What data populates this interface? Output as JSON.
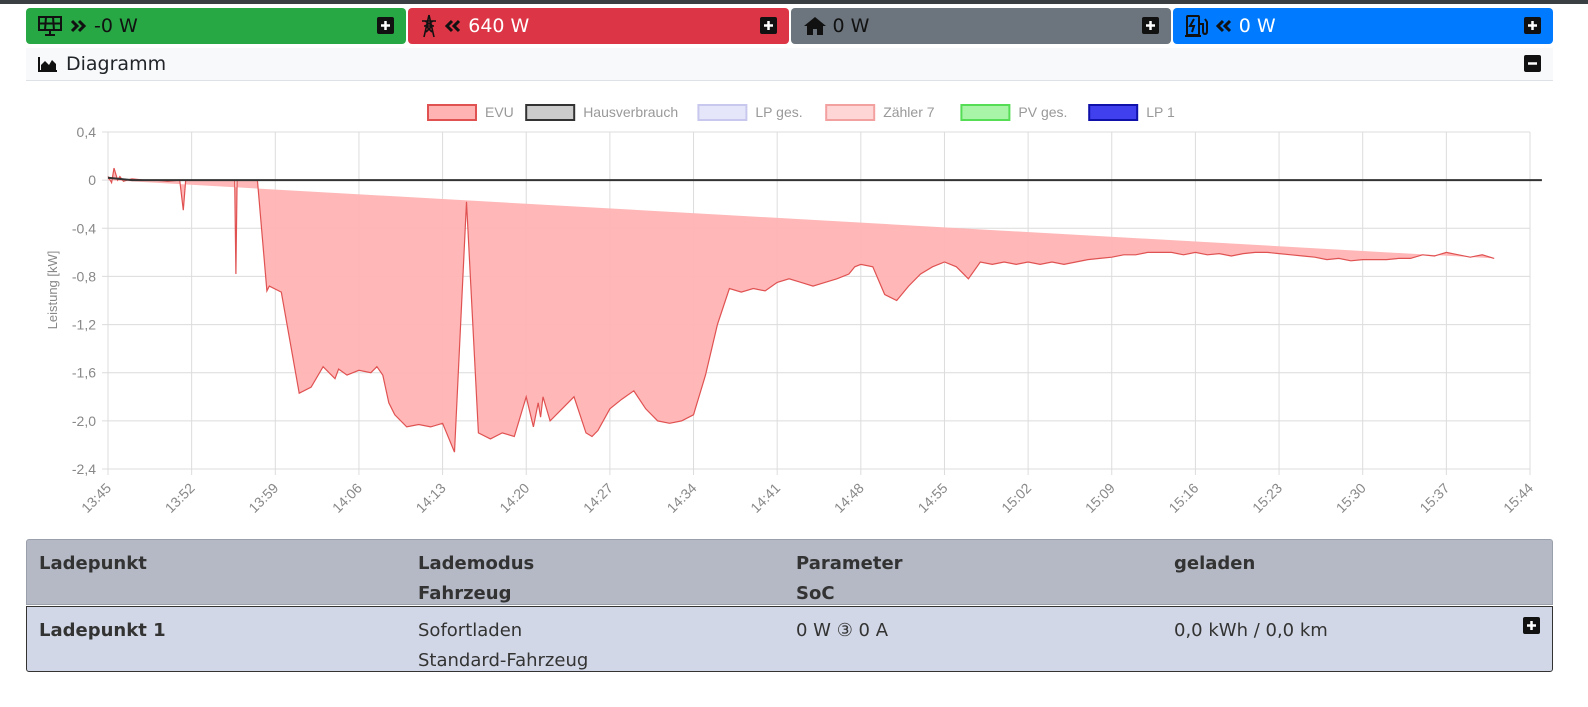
{
  "tiles": [
    {
      "label": "-0 W",
      "color": "#28a745",
      "icon": "solar-panel-icon"
    },
    {
      "label": "640 W",
      "color": "#dc3545",
      "icon": "power-tower-icon"
    },
    {
      "label": "0 W",
      "color": "#6c757d",
      "icon": "home-icon"
    },
    {
      "label": "0 W",
      "color": "#007bff",
      "icon": "charging-station-icon"
    }
  ],
  "diagram": {
    "title": "Diagramm"
  },
  "chart_data": {
    "type": "area",
    "ylabel": "Leistung [kW]",
    "ylim": [
      -2.4,
      0.4
    ],
    "yticks": [
      "0,4",
      "0",
      "-0,4",
      "-0,8",
      "-1,2",
      "-1,6",
      "-2,0",
      "-2,4"
    ],
    "xticks": [
      "13:45",
      "13:52",
      "13:59",
      "14:06",
      "14:13",
      "14:20",
      "14:27",
      "14:34",
      "14:41",
      "14:48",
      "14:55",
      "15:02",
      "15:09",
      "15:16",
      "15:23",
      "15:30",
      "15:37",
      "15:44"
    ],
    "legend": [
      {
        "name": "EVU",
        "fill": "#ffb3b3",
        "stroke": "#e05252"
      },
      {
        "name": "Hausverbrauch",
        "fill": "#cccccc",
        "stroke": "#333333"
      },
      {
        "name": "LP ges.",
        "fill": "#e6e6fa",
        "stroke": "#c8c8ee"
      },
      {
        "name": "Zähler 7",
        "fill": "#ffd6d6",
        "stroke": "#f3a0a0"
      },
      {
        "name": "PV ges.",
        "fill": "#a8f5a8",
        "stroke": "#55dd55"
      },
      {
        "name": "LP 1",
        "fill": "#4040ee",
        "stroke": "#1010aa"
      }
    ],
    "series": [
      {
        "name": "EVU",
        "x_min": [
          0,
          0.3,
          0.5,
          0.8,
          1,
          1.3,
          1.6,
          2,
          3,
          4,
          5,
          6,
          6.3,
          6.5,
          7,
          8,
          9,
          10,
          10.6,
          10.7,
          10.8,
          11,
          11.5,
          12.5,
          13.3,
          13.5,
          14.5,
          16,
          17,
          18,
          19,
          19.3,
          20,
          21,
          22,
          22.5,
          23,
          23.5,
          24,
          25,
          26,
          27,
          28,
          29,
          30,
          31,
          32,
          33,
          34,
          35,
          35.6,
          36,
          36.2,
          36.4,
          37,
          38,
          39,
          40,
          40.5,
          41,
          42,
          43,
          44,
          45,
          46,
          47,
          48,
          49,
          50,
          51,
          52,
          53,
          54,
          55,
          56,
          57,
          58,
          59,
          60,
          61,
          62,
          62.5,
          63,
          64,
          65,
          66,
          67,
          68,
          69,
          70,
          71,
          72,
          73,
          74,
          75,
          76,
          77,
          78,
          79,
          80,
          81,
          82,
          83,
          84,
          85,
          86,
          87,
          88,
          89,
          90,
          91,
          92,
          93,
          94,
          95,
          96,
          97,
          98,
          99,
          100,
          101,
          102,
          103,
          104,
          105,
          106,
          107,
          108,
          109,
          110,
          111,
          112,
          113,
          114,
          115,
          116,
          117,
          118,
          119,
          119.5
        ],
        "values": [
          0.03,
          -0.02,
          0.1,
          0.0,
          0.03,
          -0.01,
          0.0,
          0.01,
          0.0,
          0.0,
          -0.01,
          0.0,
          -0.25,
          0.0,
          0.0,
          0.0,
          0.0,
          0.0,
          0.0,
          -0.78,
          0.0,
          0.0,
          0.0,
          0.0,
          -0.92,
          -0.88,
          -0.93,
          -1.77,
          -1.72,
          -1.55,
          -1.65,
          -1.57,
          -1.62,
          -1.58,
          -1.6,
          -1.55,
          -1.62,
          -1.85,
          -1.95,
          -2.05,
          -2.03,
          -2.05,
          -2.02,
          -2.26,
          -0.18,
          -2.1,
          -2.15,
          -2.1,
          -2.13,
          -1.8,
          -2.05,
          -1.85,
          -1.97,
          -1.8,
          -2.0,
          -1.9,
          -1.8,
          -2.1,
          -2.13,
          -2.08,
          -1.9,
          -1.82,
          -1.75,
          -1.9,
          -2.0,
          -2.02,
          -2.0,
          -1.95,
          -1.62,
          -1.2,
          -0.9,
          -0.93,
          -0.9,
          -0.92,
          -0.85,
          -0.82,
          -0.85,
          -0.88,
          -0.85,
          -0.82,
          -0.78,
          -0.72,
          -0.7,
          -0.72,
          -0.95,
          -1.0,
          -0.88,
          -0.78,
          -0.72,
          -0.68,
          -0.72,
          -0.82,
          -0.68,
          -0.7,
          -0.68,
          -0.7,
          -0.68,
          -0.7,
          -0.68,
          -0.7,
          -0.68,
          -0.66,
          -0.65,
          -0.64,
          -0.62,
          -0.62,
          -0.6,
          -0.6,
          -0.6,
          -0.62,
          -0.6,
          -0.62,
          -0.61,
          -0.63,
          -0.61,
          -0.6,
          -0.6,
          -0.61,
          -0.62,
          -0.63,
          -0.64,
          -0.66,
          -0.65,
          -0.67,
          -0.66,
          -0.66,
          -0.66,
          -0.65,
          -0.65,
          -0.62,
          -0.63,
          -0.6,
          -0.62,
          -0.64,
          -0.62,
          -0.65
        ]
      },
      {
        "name": "Hausverbrauch",
        "x_min": [
          0,
          2,
          6,
          10,
          12,
          120
        ],
        "values": [
          0.02,
          0.0,
          0.0,
          0.0,
          0.0,
          0.0
        ]
      }
    ]
  },
  "table": {
    "headers": [
      [
        "Ladepunkt",
        ""
      ],
      [
        "Lademodus",
        "Fahrzeug"
      ],
      [
        "Parameter",
        "SoC"
      ],
      [
        "geladen",
        ""
      ]
    ],
    "row": {
      "ladepunkt": "Ladepunkt 1",
      "lademodus": "Sofortladen",
      "fahrzeug": "Standard-Fahrzeug",
      "parameter": "0 W ③ 0 A",
      "geladen": "0,0 kWh / 0,0 km"
    }
  }
}
